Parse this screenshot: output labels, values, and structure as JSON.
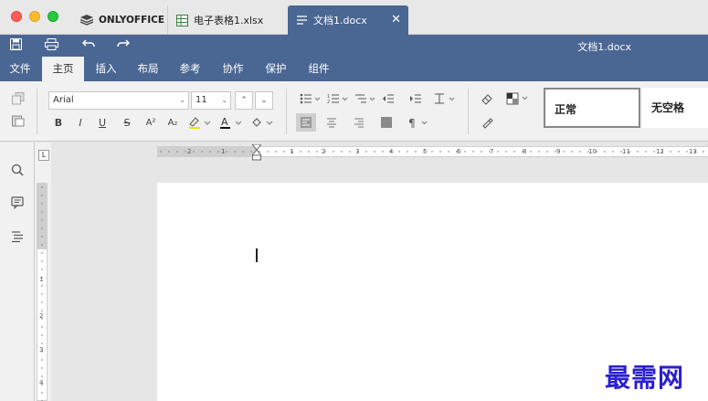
{
  "window": {
    "tabs": [
      {
        "label": "ONLYOFFICE",
        "icon": "onlyoffice-logo-icon"
      },
      {
        "label": "电子表格1.xlsx",
        "icon": "spreadsheet-icon"
      },
      {
        "label": "文档1.docx",
        "icon": "document-icon"
      }
    ]
  },
  "header": {
    "doc_title": "文档1.docx",
    "buttons": [
      "save-icon",
      "print-icon",
      "undo-icon",
      "redo-icon"
    ]
  },
  "menu": {
    "items": [
      "文件",
      "主页",
      "插入",
      "布局",
      "参考",
      "协作",
      "保护",
      "组件"
    ],
    "active": "主页"
  },
  "toolbar": {
    "font_name": "Arial",
    "font_size": "11",
    "format_buttons": [
      "B",
      "I",
      "U",
      "S",
      "A²",
      "A₂"
    ],
    "styles": [
      "正常",
      "无空格"
    ]
  },
  "hruler": {
    "labels": [
      "2",
      "1",
      "1",
      "1",
      "2",
      "3",
      "4",
      "5",
      "6",
      "7",
      "8",
      "9",
      "10",
      "11",
      "12",
      "13"
    ]
  },
  "vruler": {
    "labels": [
      "1",
      "2",
      "3",
      "4"
    ]
  },
  "watermark": "最需网",
  "colors": {
    "accent": "#4a6693",
    "toolbar": "#f1f1f1",
    "watermark": "#2a1fcf"
  }
}
